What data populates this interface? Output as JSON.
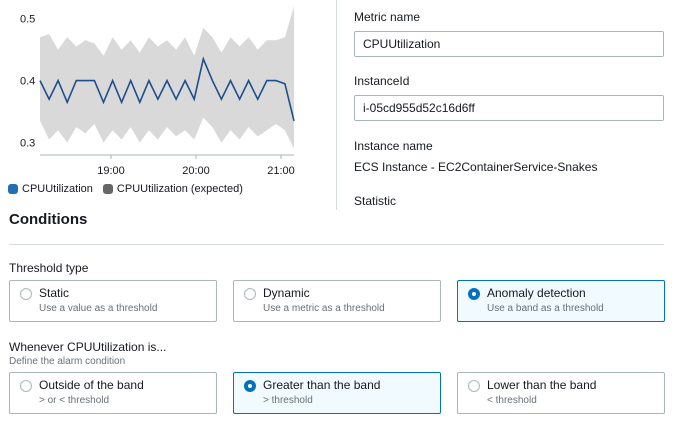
{
  "chart_data": {
    "type": "line",
    "x_ticks": [
      "19:00",
      "20:00",
      "21:00"
    ],
    "y_ticks": [
      "0.5",
      "0.4",
      "0.3"
    ],
    "ylim": [
      0.3,
      0.5
    ],
    "series": [
      {
        "name": "CPUUtilization",
        "color": "#1f4e8c",
        "values": [
          0.4,
          0.37,
          0.4,
          0.365,
          0.4,
          0.4,
          0.4,
          0.365,
          0.4,
          0.365,
          0.4,
          0.365,
          0.4,
          0.37,
          0.4,
          0.37,
          0.4,
          0.37,
          0.435,
          0.4,
          0.37,
          0.4,
          0.37,
          0.4,
          0.37,
          0.4,
          0.4,
          0.395,
          0.335
        ]
      }
    ],
    "band": {
      "name": "CPUUtilization (expected)",
      "color": "#d9d9d9",
      "upper": [
        0.47,
        0.475,
        0.45,
        0.47,
        0.455,
        0.465,
        0.46,
        0.44,
        0.47,
        0.45,
        0.465,
        0.445,
        0.47,
        0.455,
        0.465,
        0.45,
        0.47,
        0.44,
        0.485,
        0.47,
        0.445,
        0.47,
        0.455,
        0.47,
        0.45,
        0.465,
        0.465,
        0.47,
        0.52
      ],
      "lower": [
        0.335,
        0.305,
        0.32,
        0.3,
        0.325,
        0.315,
        0.33,
        0.3,
        0.32,
        0.305,
        0.325,
        0.3,
        0.32,
        0.305,
        0.325,
        0.31,
        0.32,
        0.305,
        0.34,
        0.325,
        0.3,
        0.32,
        0.305,
        0.325,
        0.31,
        0.32,
        0.33,
        0.32,
        0.29
      ]
    },
    "legend": [
      "CPUUtilization",
      "CPUUtilization (expected)"
    ],
    "legend_colors": [
      "#1f6fb2",
      "#666666"
    ],
    "legend_placement": "bottom-left",
    "grid": false
  },
  "details": {
    "metric_name_label": "Metric name",
    "metric_name_value": "CPUUtilization",
    "instance_id_label": "InstanceId",
    "instance_id_value": "i-05cd955d52c16d6ff",
    "instance_name_label": "Instance name",
    "instance_name_value": "ECS Instance - EC2ContainerService-Snakes",
    "statistic_label": "Statistic"
  },
  "conditions": {
    "title": "Conditions",
    "threshold_type": {
      "label": "Threshold type",
      "options": [
        {
          "title": "Static",
          "desc": "Use a value as a threshold",
          "selected": false
        },
        {
          "title": "Dynamic",
          "desc": "Use a metric as a threshold",
          "selected": false
        },
        {
          "title": "Anomaly detection",
          "desc": "Use a band as a threshold",
          "selected": true
        }
      ]
    },
    "whenever": {
      "label": "Whenever CPUUtilization is...",
      "desc": "Define the alarm condition",
      "options": [
        {
          "title": "Outside of the band",
          "desc": "> or < threshold",
          "selected": false
        },
        {
          "title": "Greater than the band",
          "desc": "> threshold",
          "selected": true
        },
        {
          "title": "Lower than the band",
          "desc": "< threshold",
          "selected": false
        }
      ]
    }
  }
}
